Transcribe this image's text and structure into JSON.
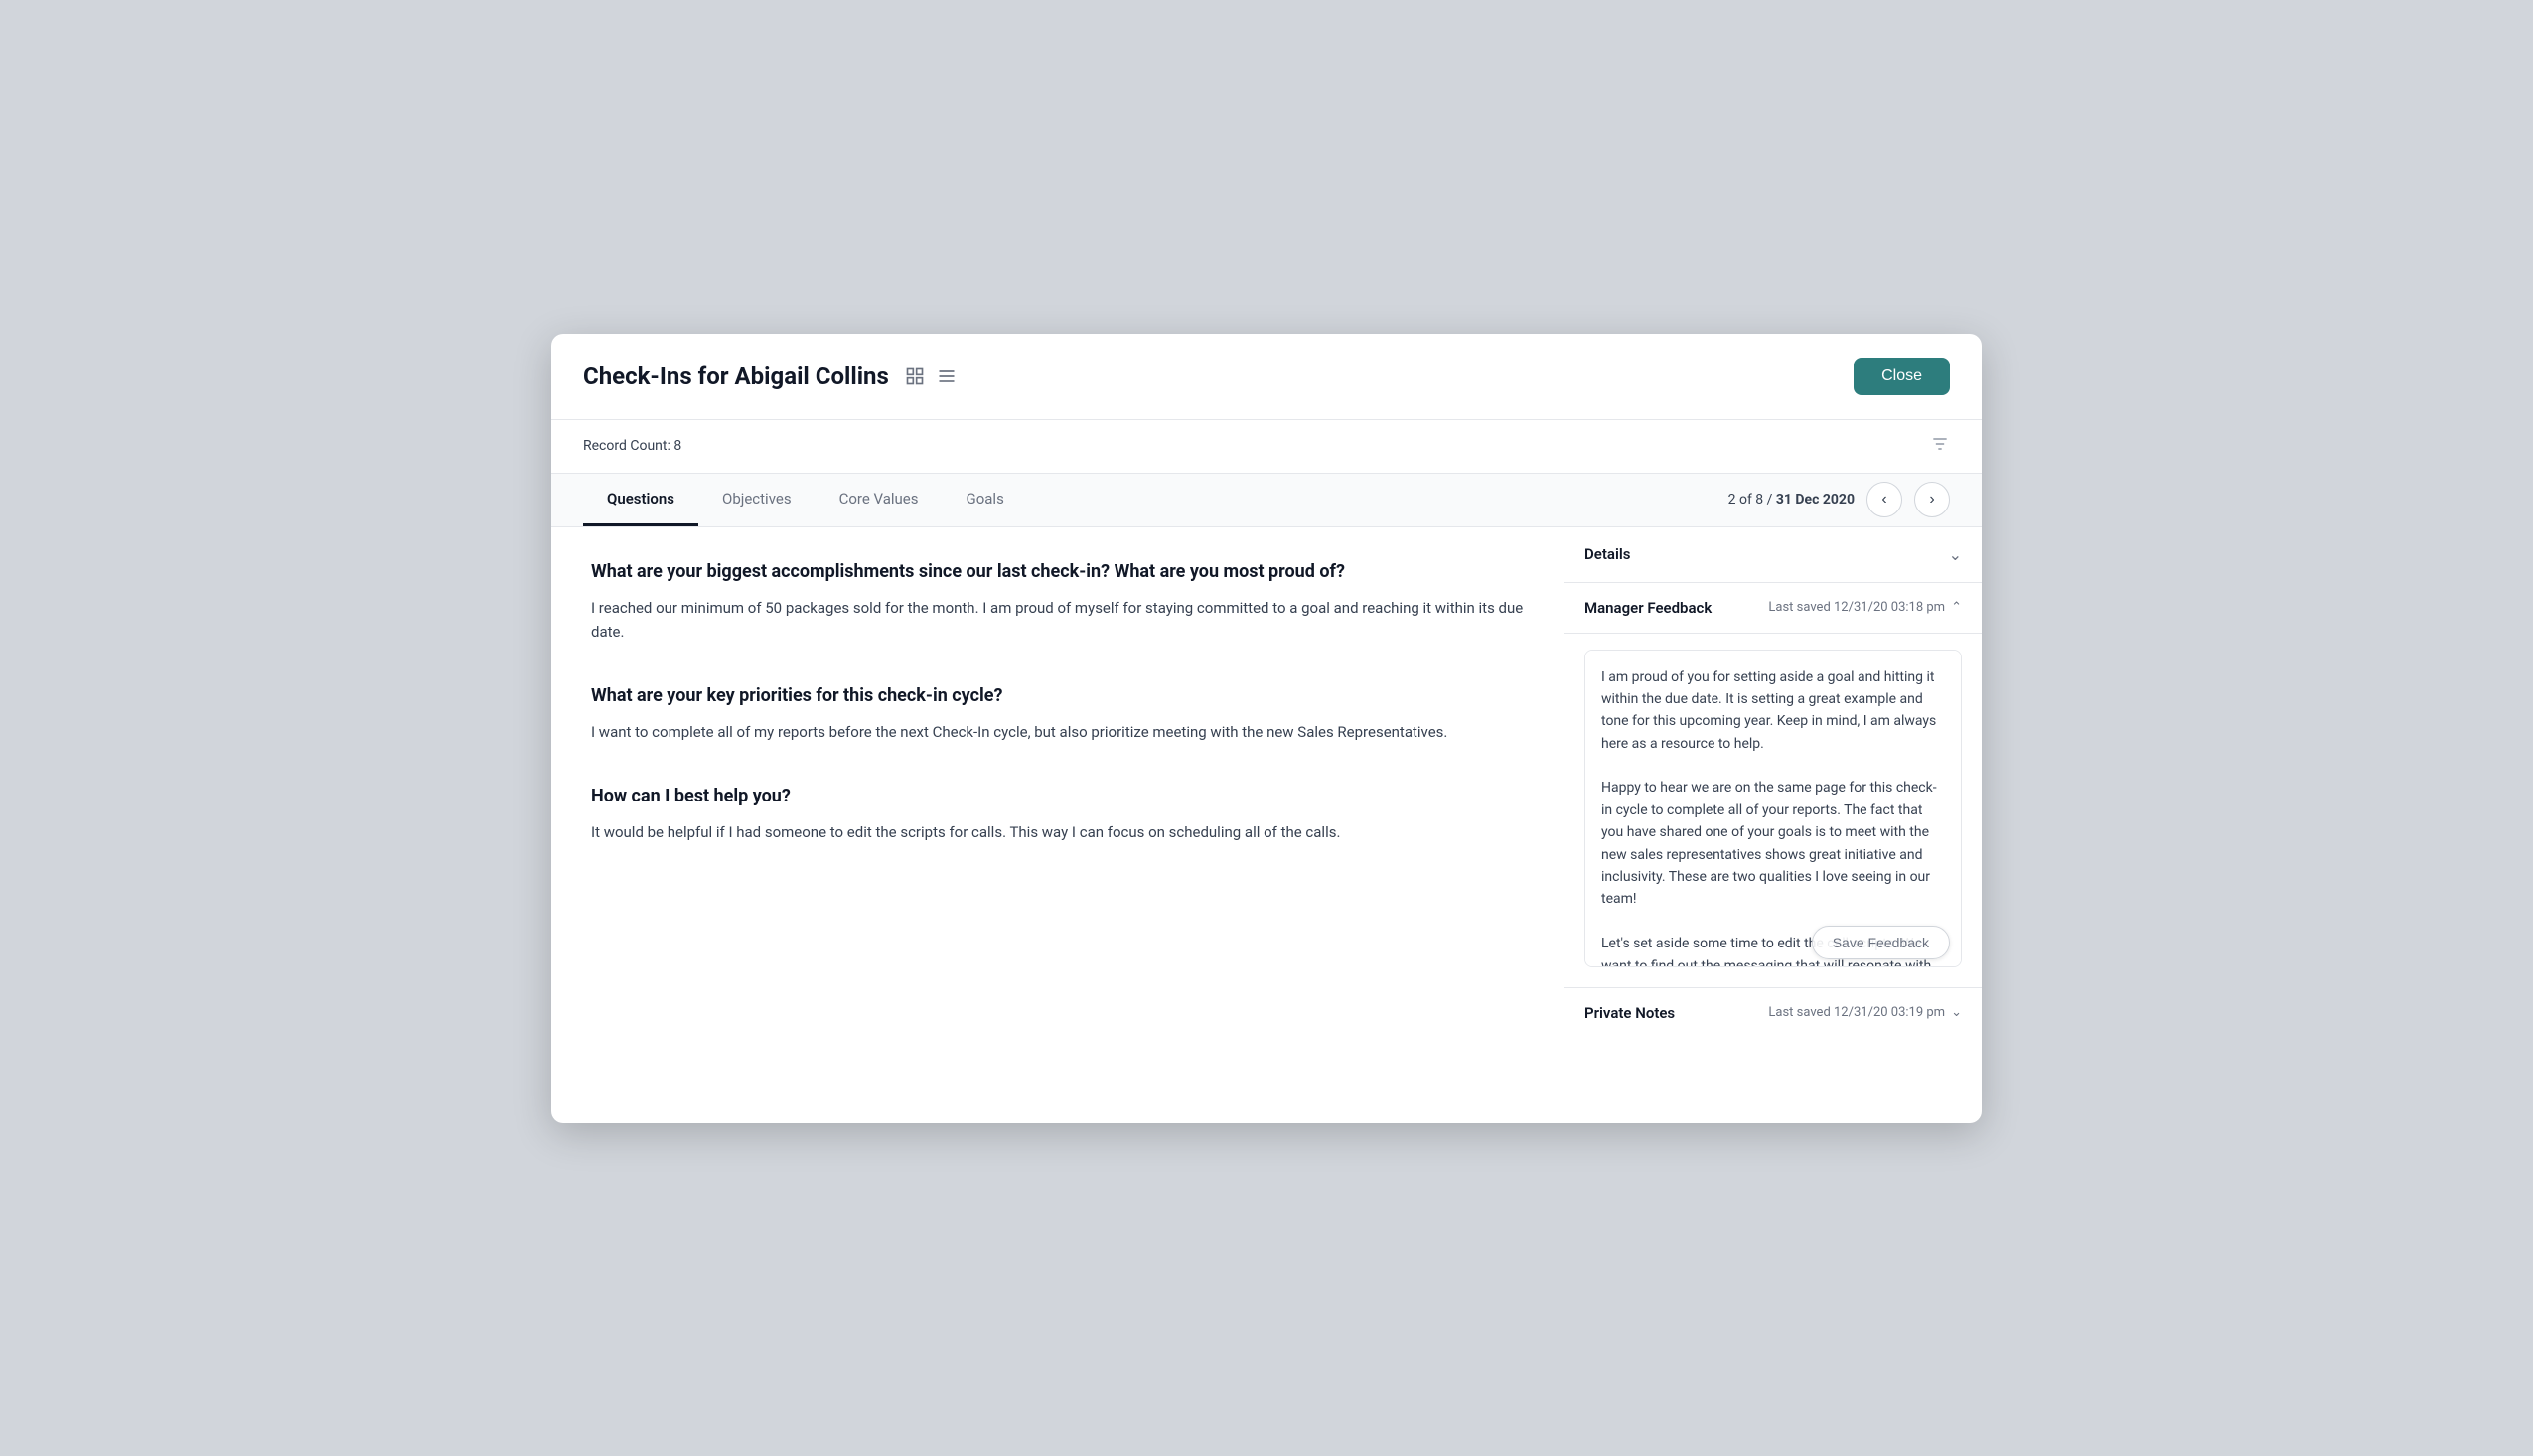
{
  "header": {
    "title": "Check-Ins for Abigail Collins",
    "close_label": "Close"
  },
  "record_bar": {
    "label": "Record Count:",
    "count": "8"
  },
  "tabs": [
    {
      "id": "questions",
      "label": "Questions",
      "active": true
    },
    {
      "id": "objectives",
      "label": "Objectives",
      "active": false
    },
    {
      "id": "core-values",
      "label": "Core Values",
      "active": false
    },
    {
      "id": "goals",
      "label": "Goals",
      "active": false
    }
  ],
  "pagination": {
    "current": "2",
    "total": "8",
    "date": "31 Dec 2020",
    "label_prefix": "2 of 8 / "
  },
  "questions": [
    {
      "id": "q1",
      "title": "What are your biggest accomplishments since our last check-in? What are you most proud of?",
      "answer": "I reached our minimum of 50 packages sold for the month. I am proud of myself for staying committed to a goal and reaching it within its due date."
    },
    {
      "id": "q2",
      "title": "What are your key priorities for this check-in cycle?",
      "answer": "I want to complete all of my reports before the next Check-In cycle, but also prioritize meeting with the new Sales Representatives."
    },
    {
      "id": "q3",
      "title": "How can I best help you?",
      "answer": "It would be helpful if I had someone to edit the scripts for calls. This way I can focus on scheduling all of the calls."
    }
  ],
  "right_panel": {
    "details_label": "Details",
    "manager_feedback": {
      "title": "Manager Feedback",
      "last_saved": "Last saved 12/31/20 03:18 pm",
      "feedback_text": "I am proud of you for setting aside a goal and hitting it within the due date. It is setting a great example and tone for this upcoming year. Keep in mind, I am always here as a resource to help.\n\nHappy to hear we are on the same page for this check-in cycle to complete all of your reports. The fact that you have shared one of your goals is to meet with the new sales representatives shows great initiative and inclusivity. These are two qualities I love seeing in our team!\n\nLet's set aside some time to edit the call scripts. We want to find out the messaging that will resonate with our prospects.",
      "save_button_label": "Save Feedback"
    },
    "private_notes": {
      "title": "Private Notes",
      "last_saved": "Last saved 12/31/20 03:19 pm"
    }
  }
}
